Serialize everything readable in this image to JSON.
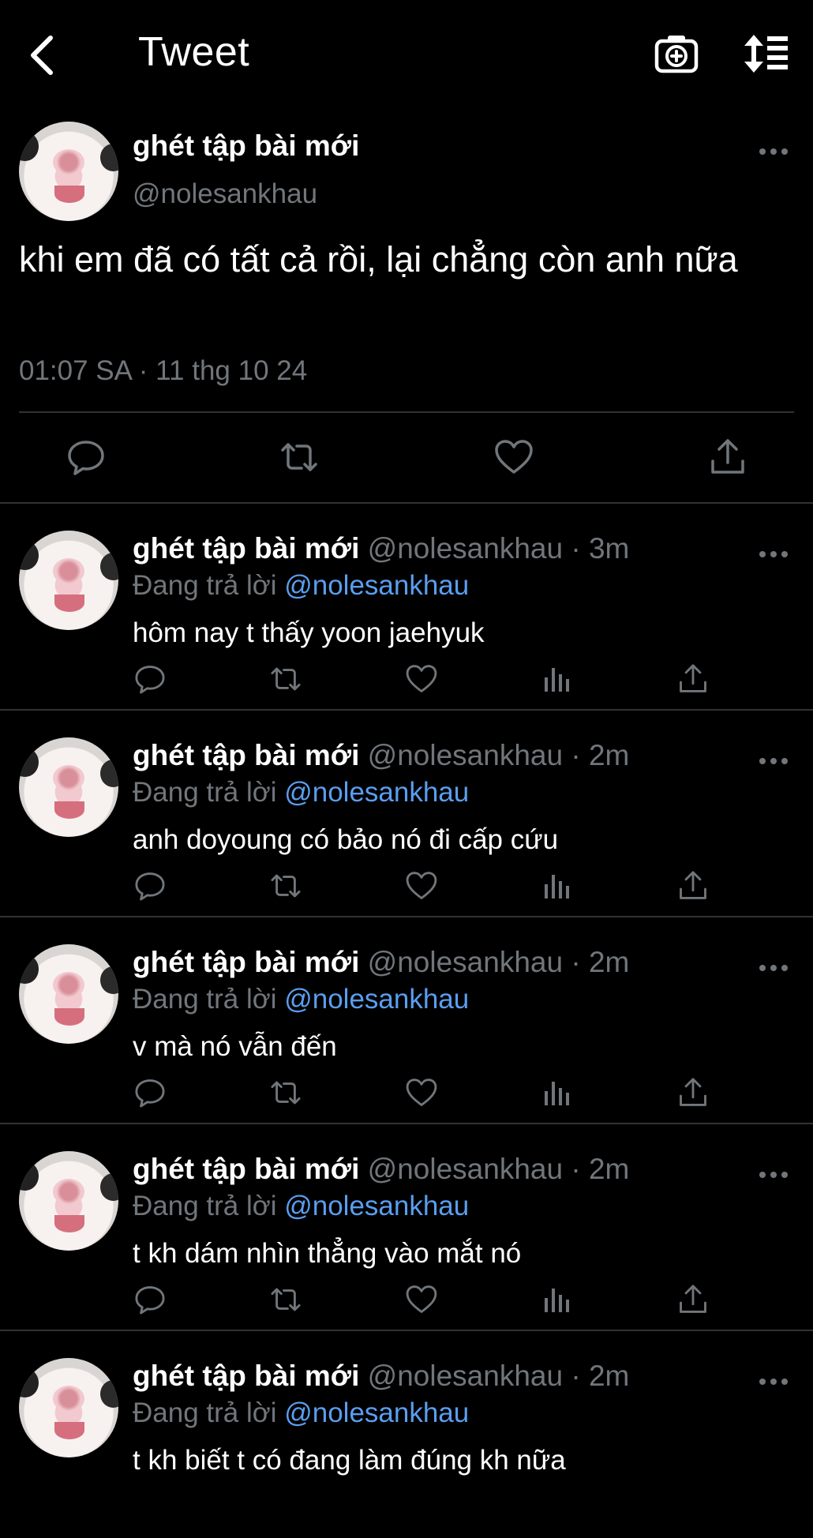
{
  "header": {
    "title": "Tweet",
    "back_icon": "chevron-left-icon",
    "camera_icon": "camera-plus-icon",
    "sort_icon": "sort-list-icon"
  },
  "main_tweet": {
    "name": "ghét tập bài mới",
    "handle": "@nolesankhau",
    "text": "khi em đã có tất cả rồi, lại chẳng còn anh nữa",
    "timestamp": "01:07 SA · 11 thg 10 24",
    "actions": [
      "reply-icon",
      "retweet-icon",
      "like-icon",
      "share-icon"
    ]
  },
  "colors": {
    "background": "#000000",
    "text": "#e7e9ea",
    "muted": "#71767b",
    "link": "#5a9ef0",
    "divider": "#2f3336"
  },
  "replies": [
    {
      "name": "ghét tập bài mới",
      "meta": "@nolesankhau · 3m",
      "replying_prefix": "Đang trả lời",
      "mention": "@nolesankhau",
      "text": "hôm nay t thấy yoon jaehyuk"
    },
    {
      "name": "ghét tập bài mới",
      "meta": "@nolesankhau · 2m",
      "replying_prefix": "Đang trả lời",
      "mention": "@nolesankhau",
      "text": "anh doyoung có bảo nó đi cấp cứu"
    },
    {
      "name": "ghét tập bài mới",
      "meta": "@nolesankhau · 2m",
      "replying_prefix": "Đang trả lời",
      "mention": "@nolesankhau",
      "text": "v mà nó vẫn đến"
    },
    {
      "name": "ghét tập bài mới",
      "meta": "@nolesankhau · 2m",
      "replying_prefix": "Đang trả lời",
      "mention": "@nolesankhau",
      "text": "t kh dám nhìn thẳng vào mắt nó"
    },
    {
      "name": "ghét tập bài mới",
      "meta": "@nolesankhau · 2m",
      "replying_prefix": "Đang trả lời",
      "mention": "@nolesankhau",
      "text": "t kh biết t có đang làm đúng kh nữa"
    }
  ]
}
